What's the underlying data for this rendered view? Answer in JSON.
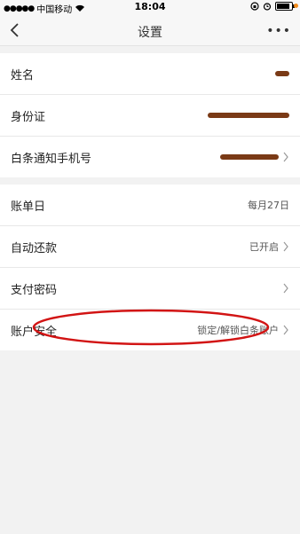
{
  "status_bar": {
    "carrier": "中国移动",
    "time": "18:04"
  },
  "nav": {
    "title": "设置",
    "more": "•••"
  },
  "profile": [
    {
      "label": "姓名"
    },
    {
      "label": "身份证"
    },
    {
      "label": "白条通知手机号"
    }
  ],
  "settings": [
    {
      "label": "账单日",
      "value": "每月27日"
    },
    {
      "label": "自动还款",
      "value": "已开启"
    },
    {
      "label": "支付密码",
      "value": ""
    },
    {
      "label": "账户安全",
      "value": "锁定/解锁白条账户"
    }
  ],
  "colors": {
    "annotation": "#d21414",
    "redaction": "#7a3a16",
    "accent_dot": "#f08a1c"
  }
}
